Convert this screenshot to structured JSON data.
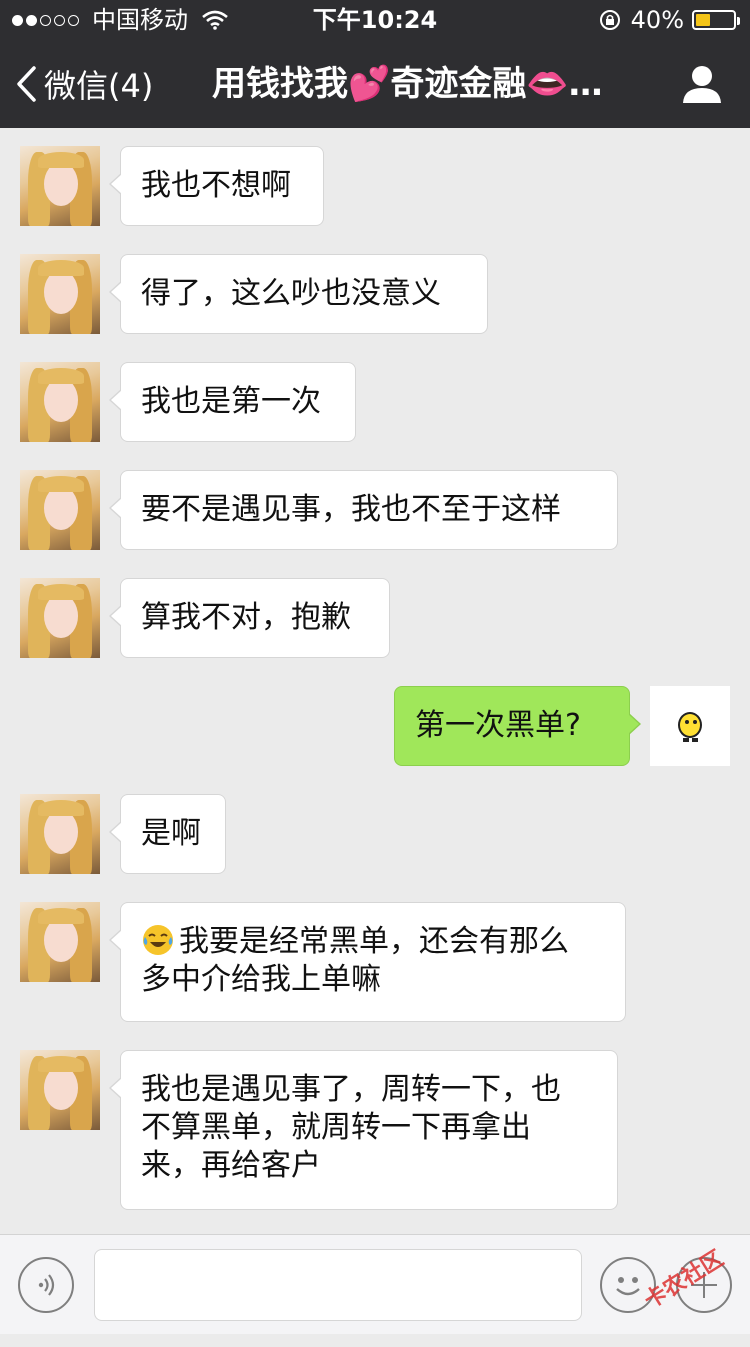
{
  "status_bar": {
    "carrier": "中国移动",
    "time": "下午10:24",
    "battery_percent": "40%",
    "battery_level": 0.4
  },
  "nav": {
    "back_label": "微信(4)",
    "title": "用钱找我💕奇迹金融👄…"
  },
  "messages": [
    {
      "sender": "other",
      "text": "我也不想啊"
    },
    {
      "sender": "other",
      "text": "得了，这么吵也没意义"
    },
    {
      "sender": "other",
      "text": "我也是第一次"
    },
    {
      "sender": "other",
      "text": "要不是遇见事，我也不至于这样"
    },
    {
      "sender": "other",
      "text": "算我不对，抱歉"
    },
    {
      "sender": "me",
      "text": "第一次黑单?"
    },
    {
      "sender": "other",
      "text": "是啊"
    },
    {
      "sender": "other",
      "emoji": "laugh-cry-emoji",
      "text_line1": "我要是经常黑单，还会有那么",
      "text_line2": "多中介给我上单嘛"
    },
    {
      "sender": "other",
      "text_line1": "我也是遇见事了，周转一下，也",
      "text_line2": "不算黑单，就周转一下再拿出",
      "text_line3": "来，再给客户"
    }
  ],
  "watermark": "卡农社区",
  "colors": {
    "header_bg": "#2e2e31",
    "chat_bg": "#ebebeb",
    "my_bubble": "#a0e75a",
    "other_bubble": "#ffffff",
    "battery_fill": "#f5c518"
  }
}
